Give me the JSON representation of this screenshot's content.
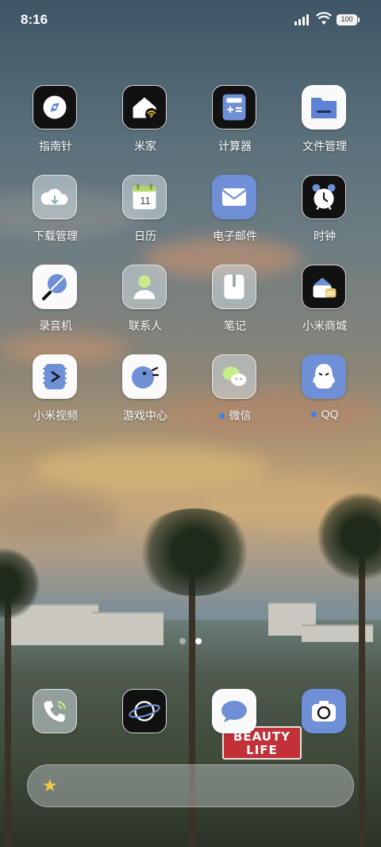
{
  "status": {
    "time": "8:16",
    "battery": "100"
  },
  "apps": [
    {
      "label": "指南针",
      "icon": "compass-icon"
    },
    {
      "label": "米家",
      "icon": "smart-home-icon"
    },
    {
      "label": "计算器",
      "icon": "calculator-icon"
    },
    {
      "label": "文件管理",
      "icon": "folder-icon"
    },
    {
      "label": "下载管理",
      "icon": "download-cloud-icon"
    },
    {
      "label": "日历",
      "icon": "calendar-icon",
      "day": "11"
    },
    {
      "label": "电子邮件",
      "icon": "mail-icon"
    },
    {
      "label": "时钟",
      "icon": "alarm-clock-icon"
    },
    {
      "label": "录音机",
      "icon": "recorder-icon"
    },
    {
      "label": "联系人",
      "icon": "contacts-icon"
    },
    {
      "label": "笔记",
      "icon": "notes-icon"
    },
    {
      "label": "小米商城",
      "icon": "store-icon"
    },
    {
      "label": "小米视频",
      "icon": "video-icon"
    },
    {
      "label": "游戏中心",
      "icon": "game-center-icon"
    },
    {
      "label": "微信",
      "icon": "wechat-icon",
      "notify": true
    },
    {
      "label": "QQ",
      "icon": "qq-icon",
      "notify": true
    }
  ],
  "dock": [
    {
      "icon": "phone-icon"
    },
    {
      "icon": "browser-icon"
    },
    {
      "icon": "messages-icon"
    },
    {
      "icon": "camera-icon"
    }
  ],
  "billboard": {
    "line1": "BEAUTY",
    "line2": "LIFE"
  },
  "colors": {
    "accent_blue": "#6f8fd6",
    "notify_dot": "#3d7ef5",
    "star": "#f2c94c"
  }
}
